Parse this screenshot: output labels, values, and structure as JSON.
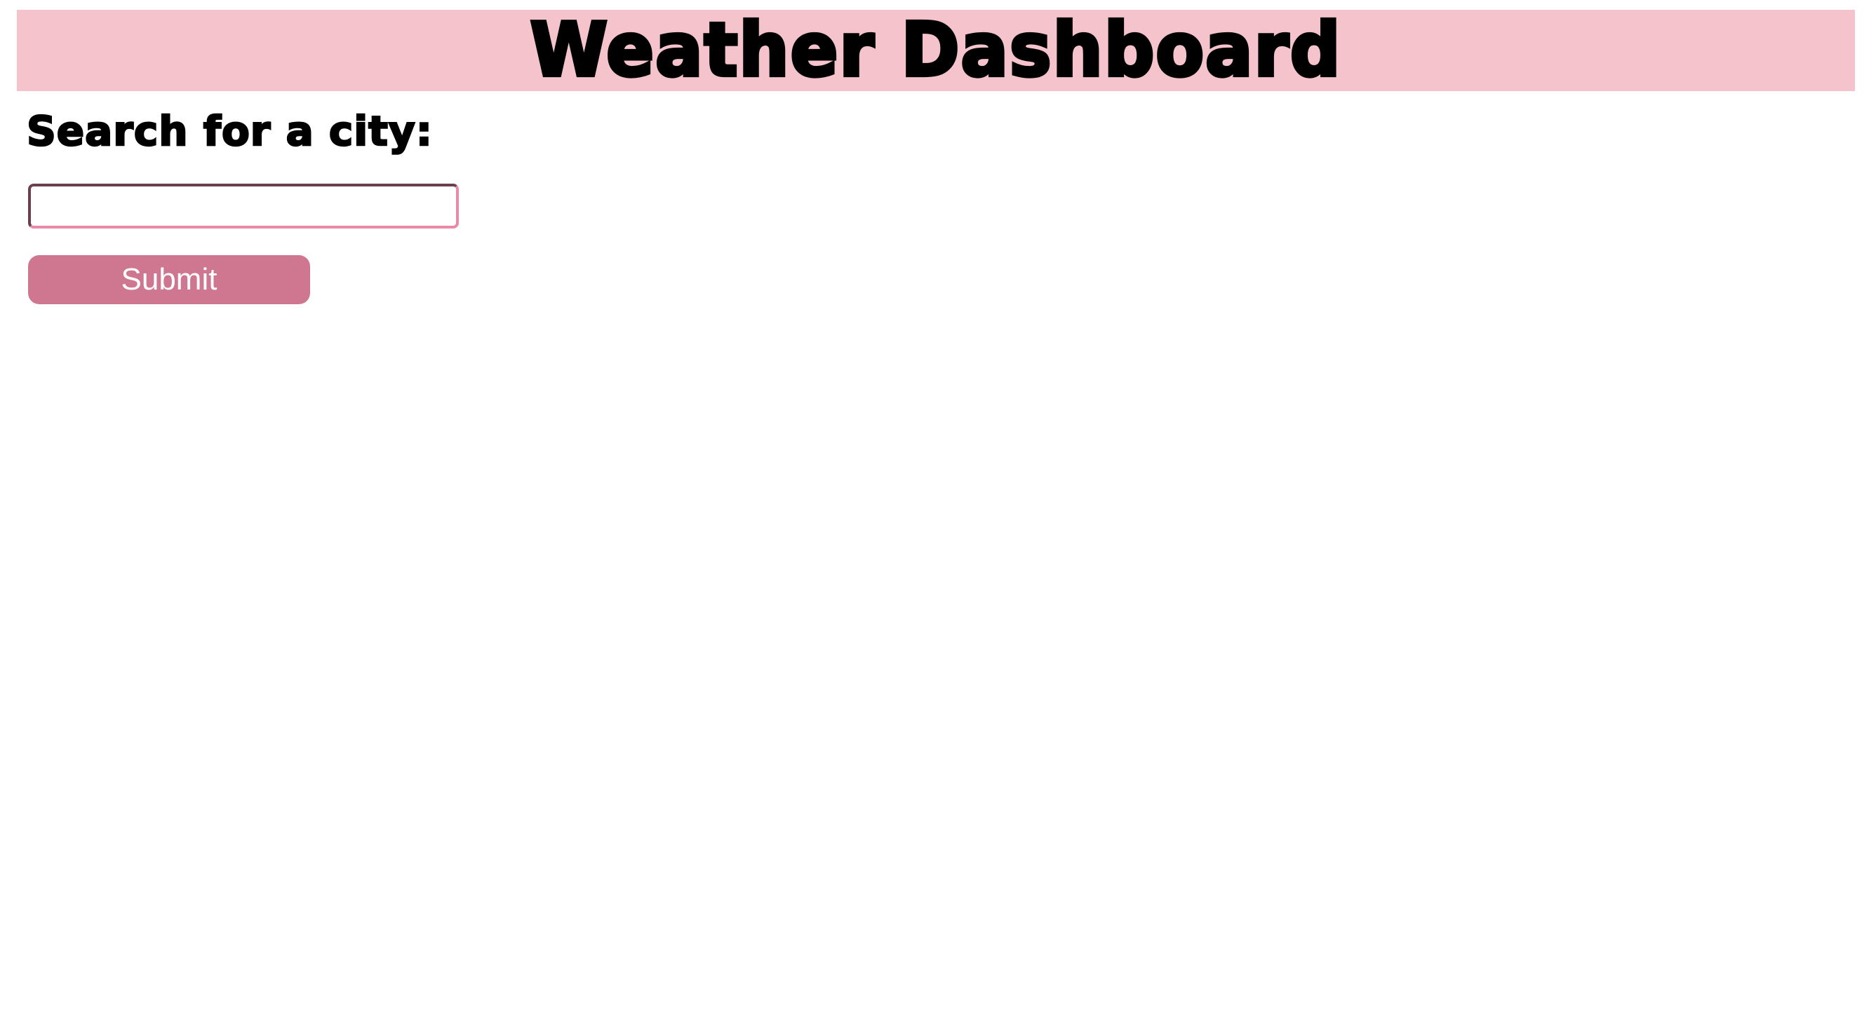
{
  "header": {
    "title": "Weather Dashboard",
    "background_color": "#f5c3cc"
  },
  "search": {
    "heading": "Search for a city:",
    "input_value": "",
    "submit_label": "Submit",
    "button_color": "#cf7791"
  }
}
